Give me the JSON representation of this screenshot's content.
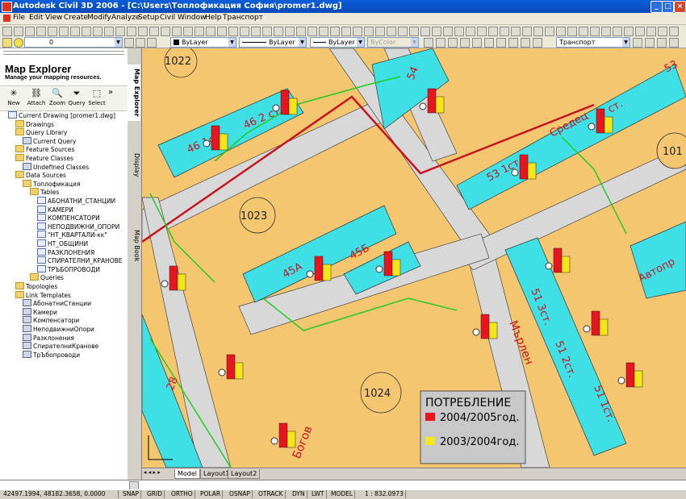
{
  "window": {
    "title": "Autodesk Civil 3D 2006 - [C:\\Users\\Топлофикация София\\promer1.dwg]",
    "controls": [
      "_",
      "□",
      "×"
    ]
  },
  "menu": [
    "File",
    "Edit",
    "View",
    "Create",
    "Modify",
    "Analyze",
    "Setup",
    "Civil",
    "Window",
    "Help",
    "Транспорт"
  ],
  "toolbar": {
    "layer_value": "0",
    "color_value": "ByLayer",
    "linetype_value": "ByLayer",
    "lineweight_value": "ByLayer",
    "plotstyle_value": "ByColor",
    "style_value": "Транспорт"
  },
  "panel": {
    "title": "Map Explorer",
    "subtitle": "Manage your mapping resources.",
    "buttons": [
      "New",
      "Attach",
      "Zoom",
      "Query",
      "Select"
    ],
    "more": "»",
    "tree": [
      {
        "label": "Current Drawing [promer1.dwg]",
        "level": 0,
        "icon": "drawing"
      },
      {
        "label": "Drawings",
        "level": 1,
        "icon": "folder"
      },
      {
        "label": "Query Library",
        "level": 1,
        "icon": "folder"
      },
      {
        "label": "Current Query",
        "level": 2,
        "icon": "query"
      },
      {
        "label": "Feature Sources",
        "level": 1,
        "icon": "folder"
      },
      {
        "label": "Feature Classes",
        "level": 1,
        "icon": "folder"
      },
      {
        "label": "Undefined Classes",
        "level": 2,
        "icon": "query"
      },
      {
        "label": "Data Sources",
        "level": 1,
        "icon": "folder"
      },
      {
        "label": "Топлофикация",
        "level": 2,
        "icon": "db"
      },
      {
        "label": "Tables",
        "level": 3,
        "icon": "folder"
      },
      {
        "label": "АБОНАТНИ_СТАНЦИИ",
        "level": 4,
        "icon": "table"
      },
      {
        "label": "КАМЕРИ",
        "level": 4,
        "icon": "table"
      },
      {
        "label": "КОМПЕНСАТОРИ",
        "level": 4,
        "icon": "table"
      },
      {
        "label": "НЕПОДВИЖНИ_ОПОРИ",
        "level": 4,
        "icon": "table"
      },
      {
        "label": "\"НТ_КВАРТАЛИ-кк\"",
        "level": 4,
        "icon": "table"
      },
      {
        "label": "НТ_ОБЩИНИ",
        "level": 4,
        "icon": "table"
      },
      {
        "label": "РАЗКЛОНЕНИЯ",
        "level": 4,
        "icon": "table"
      },
      {
        "label": "СПИРАТЕЛНИ_КРАНОВЕ",
        "level": 4,
        "icon": "table"
      },
      {
        "label": "ТРЪБОПРОВОДИ",
        "level": 4,
        "icon": "table"
      },
      {
        "label": "Queries",
        "level": 3,
        "icon": "folder"
      },
      {
        "label": "Topologies",
        "level": 1,
        "icon": "folder"
      },
      {
        "label": "Link Templates",
        "level": 1,
        "icon": "folder"
      },
      {
        "label": "АбонатниСтанции",
        "level": 2,
        "icon": "link"
      },
      {
        "label": "Камери",
        "level": 2,
        "icon": "link"
      },
      {
        "label": "Компенсатори",
        "level": 2,
        "icon": "link"
      },
      {
        "label": "НеподвижниОпори",
        "level": 2,
        "icon": "link"
      },
      {
        "label": "Разклонения",
        "level": 2,
        "icon": "link"
      },
      {
        "label": "СпирателниКранове",
        "level": 2,
        "icon": "link"
      },
      {
        "label": "ТрЪбопроводи",
        "level": 2,
        "icon": "link"
      }
    ]
  },
  "side_tabs": [
    "Map Explorer",
    "Display",
    "Map Book"
  ],
  "map": {
    "parcel_labels": [
      "1022",
      "1023",
      "1024",
      "101"
    ],
    "building_labels": [
      "46 1ст",
      "46 2 ст",
      "54",
      "53 1ст",
      "53",
      "Средец",
      "ст.",
      "45А",
      "45Б",
      "28",
      "51 3ст.",
      "51 2ст.",
      "51 1ст.",
      "Автопр"
    ],
    "street_labels": [
      "Мърлен",
      "Богов"
    ],
    "legend": {
      "title": "ПОТРЕБЛЕНИЕ",
      "items": [
        {
          "label": "2004/2005год.",
          "color": "#e8141e"
        },
        {
          "label": "2003/2004год.",
          "color": "#f5e61a"
        }
      ]
    },
    "colors": {
      "parcel": "#f4c670",
      "building": "#3ee0e6",
      "road": "#d8d8d8",
      "pipe": "#22cc22",
      "boundary": "#c8141e"
    }
  },
  "layout_tabs": [
    "Model",
    "Layout1",
    "Layout2"
  ],
  "status": {
    "coords": "42497.1994, 48182.3658, 0.0000",
    "toggles": [
      "SNAP",
      "GRID",
      "ORTHO",
      "POLAR",
      "OSNAP",
      "OTRACK",
      "DYN",
      "LWT",
      "MODEL"
    ],
    "scale": "1 : 832.0973"
  }
}
